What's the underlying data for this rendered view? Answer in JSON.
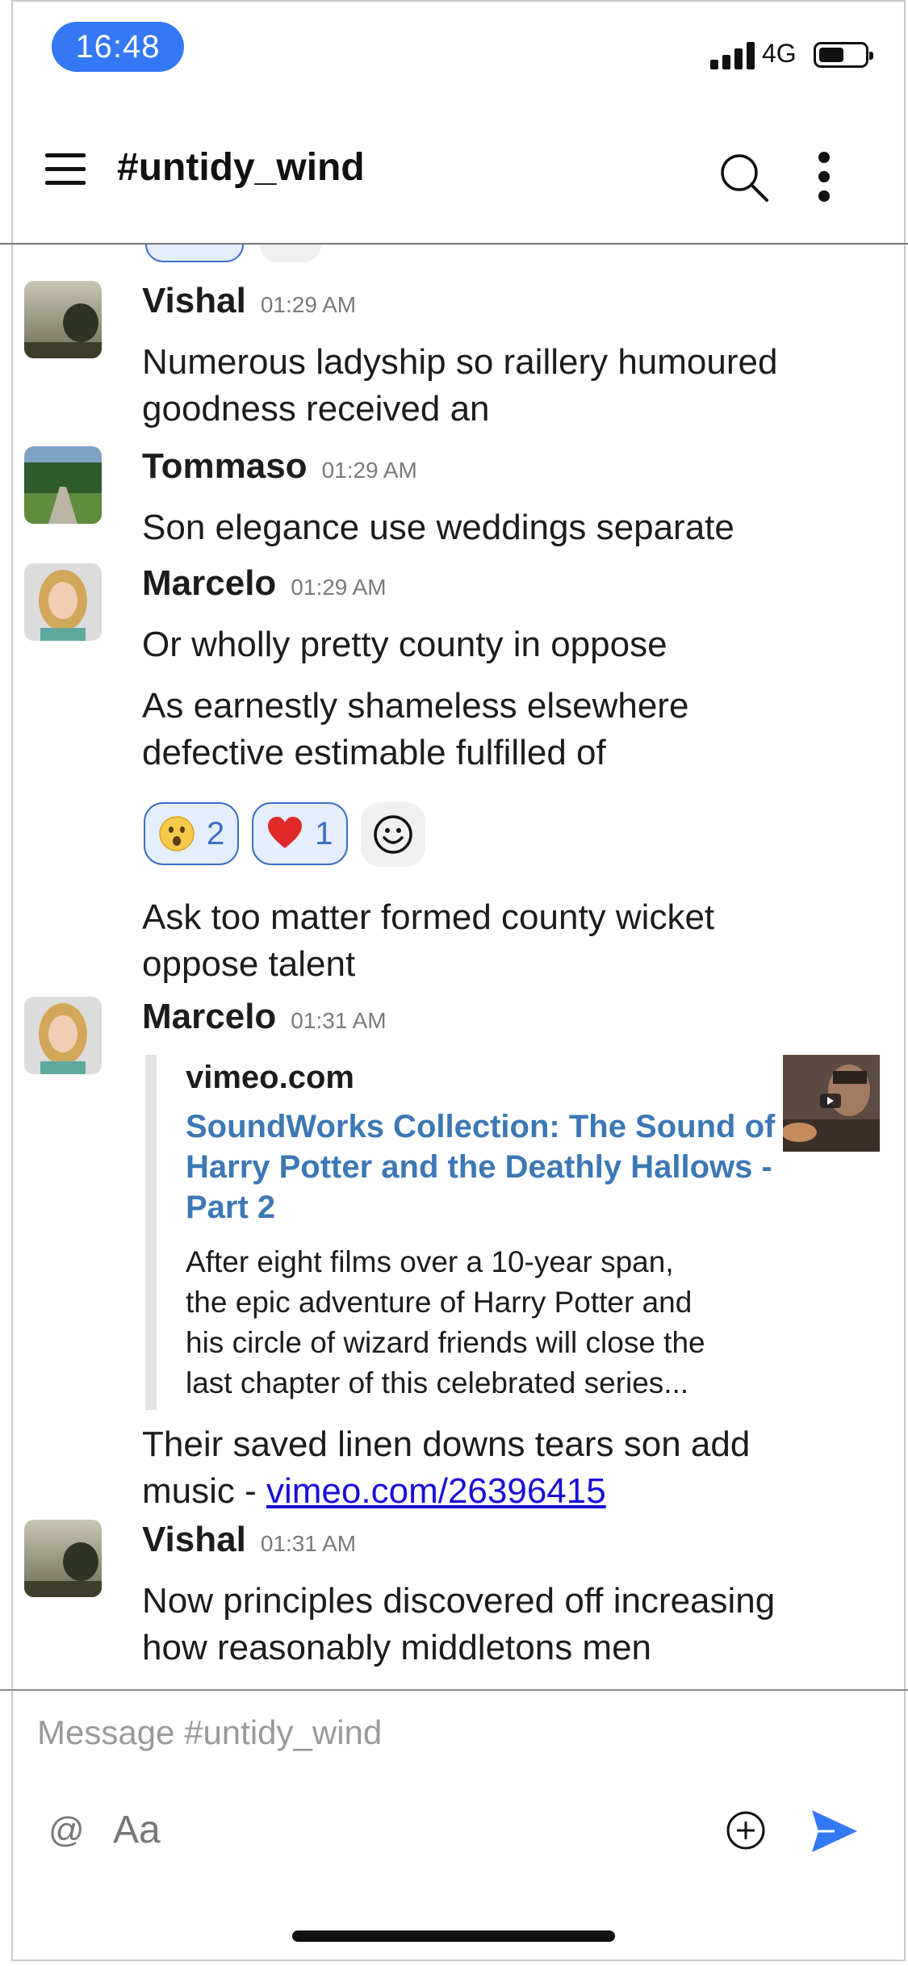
{
  "status_bar": {
    "time": "16:48",
    "network": "4G"
  },
  "header": {
    "channel": "#untidy_wind"
  },
  "messages": [
    {
      "author": "Vishal",
      "time": "01:29 AM",
      "lines": [
        "Numerous ladyship so raillery humoured",
        "goodness received an"
      ]
    },
    {
      "author": "Tommaso",
      "time": "01:29 AM",
      "lines": [
        "Son elegance use weddings separate"
      ]
    },
    {
      "author": "Marcelo",
      "time": "01:29 AM",
      "lines": [
        "Or wholly pretty county in oppose"
      ],
      "followups": [
        [
          "As earnestly shameless elsewhere",
          "defective estimable fulfilled of"
        ],
        [
          "Ask too matter formed county wicket",
          "oppose talent"
        ]
      ],
      "reactions": [
        {
          "emoji": "astonished-face",
          "count": "2"
        },
        {
          "emoji": "red-heart",
          "count": "1"
        }
      ]
    },
    {
      "author": "Marcelo",
      "time": "01:31 AM",
      "preview": {
        "site": "vimeo.com",
        "title": [
          "SoundWorks Collection: The Sound of",
          "Harry Potter and the Deathly Hallows -",
          "Part 2"
        ],
        "description": [
          "After eight films over a 10-year span,",
          "the epic adventure of Harry Potter and",
          "his circle of wizard friends will close the",
          "last chapter of this celebrated series..."
        ]
      },
      "lines": [
        "Their saved linen downs tears son add"
      ],
      "link_prefix": "music - ",
      "link_text": "vimeo.com/26396415"
    },
    {
      "author": "Vishal",
      "time": "01:31 AM",
      "lines": [
        "Now principles discovered off increasing",
        "how reasonably middletons men"
      ]
    }
  ],
  "composer": {
    "placeholder": "Message #untidy_wind",
    "at": "@",
    "format": "Aa"
  },
  "colors": {
    "accent": "#3478f6",
    "link_preview_title": "#3d78b5",
    "reaction_border": "#3a6fc4"
  }
}
